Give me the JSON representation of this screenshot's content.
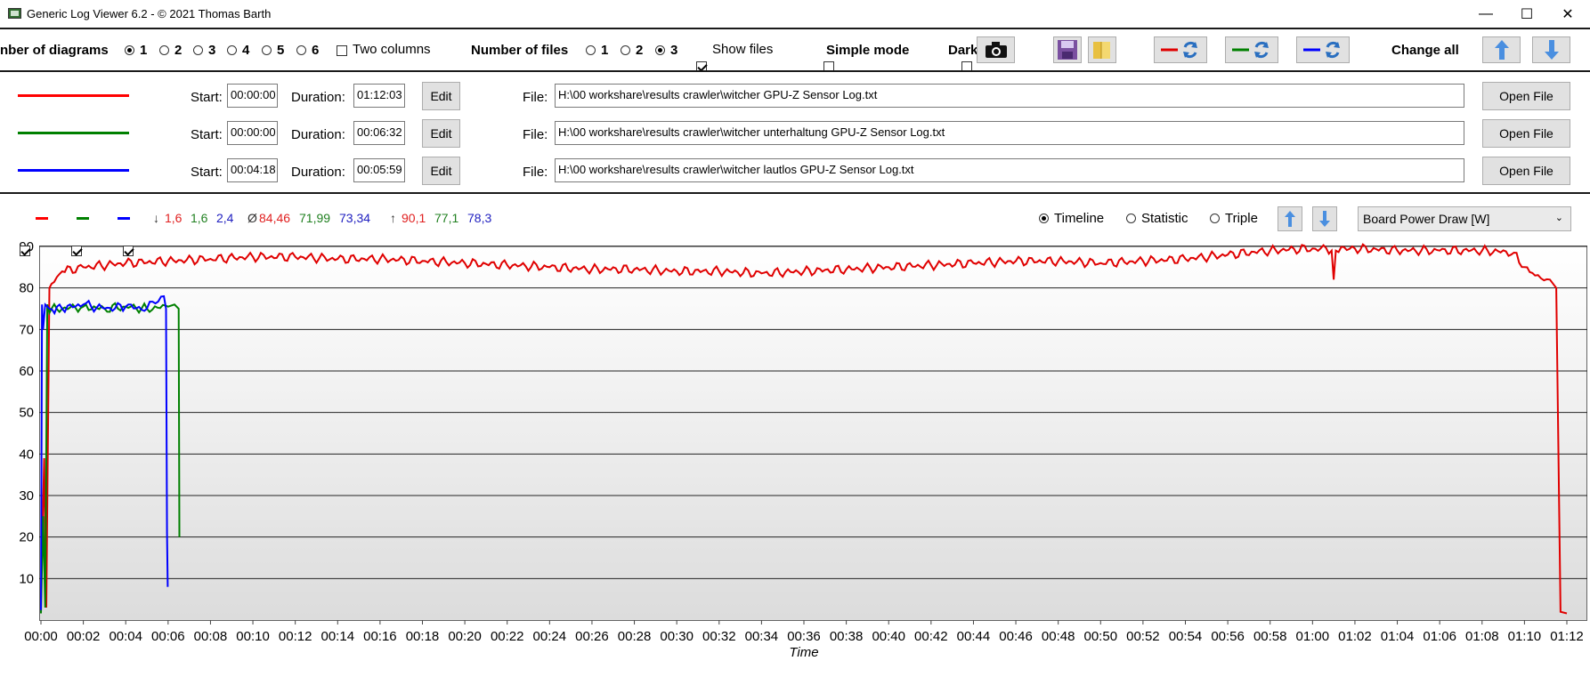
{
  "window": {
    "title": "Generic Log Viewer 6.2 - © 2021 Thomas Barth",
    "minimize": "—",
    "maximize": "☐",
    "close": "✕"
  },
  "toolbar": {
    "diagrams_label": "nber of diagrams",
    "diagram_options": [
      "1",
      "2",
      "3",
      "4",
      "5",
      "6"
    ],
    "diagram_selected": "1",
    "two_columns": "Two columns",
    "two_columns_checked": false,
    "files_label": "Number of files",
    "file_options": [
      "1",
      "2",
      "3"
    ],
    "file_selected": "3",
    "show_files": "Show files",
    "show_files_checked": true,
    "simple_mode": "Simple mode",
    "simple_mode_checked": false,
    "dark": "Dark",
    "dark_checked": false,
    "change_all": "Change all",
    "icons": [
      "camera-icon",
      "save-icon",
      "folder-icon",
      "swap-red-icon",
      "swap-green-icon",
      "swap-blue-icon",
      "arrow-up-icon",
      "arrow-down-icon"
    ]
  },
  "files": [
    {
      "color": "#ff0000",
      "start_label": "Start:",
      "start": "00:00:00",
      "duration_label": "Duration:",
      "duration": "01:12:03",
      "edit": "Edit",
      "file_label": "File:",
      "path": "H:\\00 workshare\\results crawler\\witcher GPU-Z Sensor Log.txt",
      "open": "Open File"
    },
    {
      "color": "#008000",
      "start_label": "Start:",
      "start": "00:00:00",
      "duration_label": "Duration:",
      "duration": "00:06:32",
      "edit": "Edit",
      "file_label": "File:",
      "path": "H:\\00 workshare\\results crawler\\witcher unterhaltung GPU-Z Sensor Log.txt",
      "open": "Open File"
    },
    {
      "color": "#0000ff",
      "start_label": "Start:",
      "start": "00:04:18",
      "duration_label": "Duration:",
      "duration": "00:05:59",
      "edit": "Edit",
      "file_label": "File:",
      "path": "H:\\00 workshare\\results crawler\\witcher lautlos GPU-Z Sensor Log.txt",
      "open": "Open File"
    }
  ],
  "stats": {
    "min_symbol": "↓",
    "min": [
      "1,6",
      "1,6",
      "2,4"
    ],
    "avg_symbol": "Ø",
    "avg": [
      "84,46",
      "71,99",
      "73,34"
    ],
    "max_symbol": "↑",
    "max": [
      "90,1",
      "77,1",
      "78,3"
    ],
    "colors": [
      "#e02020",
      "#208020",
      "#2020c0"
    ]
  },
  "view": {
    "options": [
      "Timeline",
      "Statistic",
      "Triple"
    ],
    "selected": "Timeline",
    "sensor": "Board Power Draw [W]"
  },
  "chart_data": {
    "type": "line",
    "xlabel": "Time",
    "ylabel": "",
    "ylim": [
      0,
      90
    ],
    "xlim_minutes": [
      0,
      72
    ],
    "yticks": [
      10,
      20,
      30,
      40,
      50,
      60,
      70,
      80,
      90
    ],
    "xticks": [
      "00:00",
      "00:02",
      "00:04",
      "00:06",
      "00:08",
      "00:10",
      "00:12",
      "00:14",
      "00:16",
      "00:18",
      "00:20",
      "00:22",
      "00:24",
      "00:26",
      "00:28",
      "00:30",
      "00:32",
      "00:34",
      "00:36",
      "00:38",
      "00:40",
      "00:42",
      "00:44",
      "00:46",
      "00:48",
      "00:50",
      "00:52",
      "00:54",
      "00:56",
      "00:58",
      "01:00",
      "01:02",
      "01:04",
      "01:06",
      "01:08",
      "01:10",
      "01:12"
    ],
    "grid": true,
    "series": [
      {
        "color": "#e00000",
        "x": [
          0,
          0.15,
          0.25,
          0.4,
          0.5,
          1,
          2,
          4,
          6,
          8,
          10,
          12,
          14,
          16,
          18,
          20,
          22,
          24,
          26,
          28,
          30,
          32,
          34,
          36,
          38,
          40,
          42,
          44,
          46,
          48,
          50,
          52,
          54,
          56,
          58,
          60,
          60.9,
          61,
          61.1,
          62,
          64,
          66,
          68,
          69.5,
          70,
          70.5,
          71.2,
          71.5,
          71.7,
          72
        ],
        "y": [
          5,
          39,
          3,
          80,
          81,
          84,
          85,
          86,
          86.5,
          87,
          87.5,
          87.5,
          87,
          87,
          86.5,
          86,
          85.5,
          85,
          84.5,
          84.5,
          84,
          84,
          83.5,
          84,
          84.5,
          85,
          85.5,
          86,
          86.5,
          86.5,
          86,
          86.5,
          87,
          88,
          89,
          89.5,
          89,
          82,
          89,
          89.5,
          89,
          89,
          89,
          88.5,
          85,
          83,
          82,
          80,
          2,
          1.6
        ]
      },
      {
        "color": "#008000",
        "x": [
          0,
          0.1,
          0.2,
          0.3,
          0.4,
          0.5,
          1,
          2,
          3,
          4,
          5,
          6,
          6.3,
          6.5,
          6.53
        ],
        "y": [
          1.6,
          25,
          3,
          76,
          74,
          75,
          75,
          75.5,
          75,
          75.5,
          75,
          75.5,
          76,
          75,
          20
        ]
      },
      {
        "color": "#0000ff",
        "x": [
          0,
          0.05,
          0.1,
          0.2,
          0.4,
          1,
          2,
          3,
          4,
          5,
          5.8,
          5.9,
          5.95,
          5.98
        ],
        "y": [
          2.4,
          76,
          70,
          76,
          75,
          75,
          76,
          75,
          75.5,
          75,
          78,
          75,
          21,
          8
        ]
      }
    ]
  }
}
